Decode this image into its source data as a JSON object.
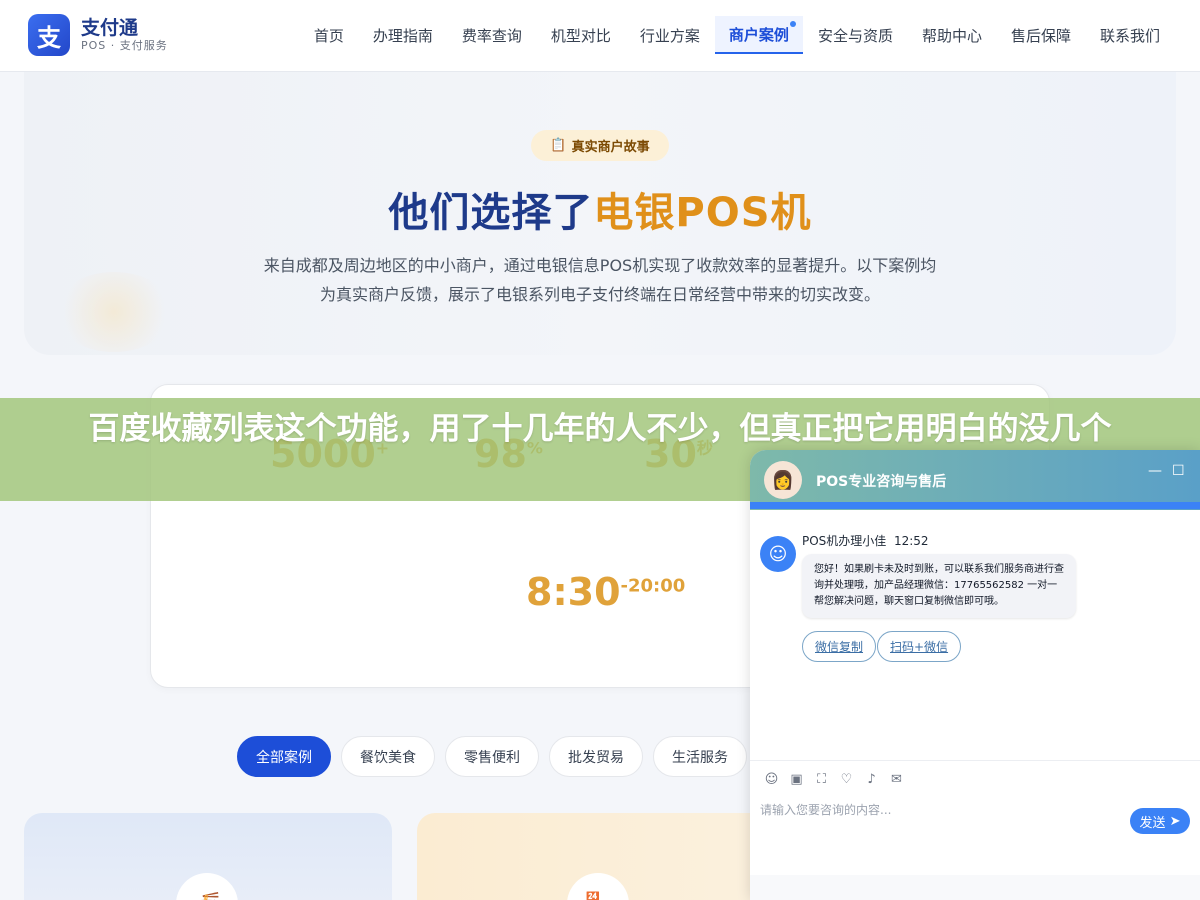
{
  "brand": {
    "mark": "支",
    "title": "支付通",
    "subtitle": "POS · 支付服务"
  },
  "nav": {
    "items": [
      {
        "label": "首页"
      },
      {
        "label": "办理指南"
      },
      {
        "label": "费率查询"
      },
      {
        "label": "机型对比"
      },
      {
        "label": "行业方案"
      },
      {
        "label": "商户案例"
      },
      {
        "label": "安全与资质"
      },
      {
        "label": "帮助中心"
      },
      {
        "label": "售后保障"
      },
      {
        "label": "联系我们"
      }
    ],
    "active_index": 5
  },
  "hero": {
    "badge": "真实商户故事",
    "title_part1": "他们选择了",
    "title_part2": "电银POS机",
    "description": "来自成都及周边地区的中小商户，通过电银信息POS机实现了收款效率的显著提升。以下案例均为真实商户反馈，展示了电银系列电子支付终端在日常经营中带来的切实改变。"
  },
  "stats": {
    "items": [
      {
        "value": "5000",
        "suffix": "+"
      },
      {
        "value": "98",
        "suffix": "%"
      },
      {
        "value": "30",
        "suffix": "秒"
      }
    ],
    "hours_start": "8:30",
    "hours_end": "-20:00"
  },
  "banner": {
    "text": "百度收藏列表这个功能，用了十几年的人不少，但真正把它用明白的没几个"
  },
  "filters": {
    "items": [
      {
        "label": "全部案例"
      },
      {
        "label": "餐饮美食"
      },
      {
        "label": "零售便利"
      },
      {
        "label": "批发贸易"
      },
      {
        "label": "生活服务"
      }
    ],
    "active_index": 0
  },
  "chat": {
    "title": "POS专业咨询与售后",
    "agent_name": "POS机办理小佳",
    "time": "12:52",
    "message": "您好！如果刷卡未及时到账，可以联系我们服务商进行查询并处理哦，加产品经理微信：17765562582 一对一帮您解决问题，聊天窗口复制微信即可哦。",
    "quick_buttons": [
      {
        "label": "微信复制"
      },
      {
        "label": "扫码+微信"
      }
    ],
    "input_placeholder": "请输入您要咨询的内容...",
    "send_label": "发送"
  },
  "colors": {
    "primary": "#1d4ed8",
    "accent": "#e0901a",
    "banner": "#a0c478"
  }
}
